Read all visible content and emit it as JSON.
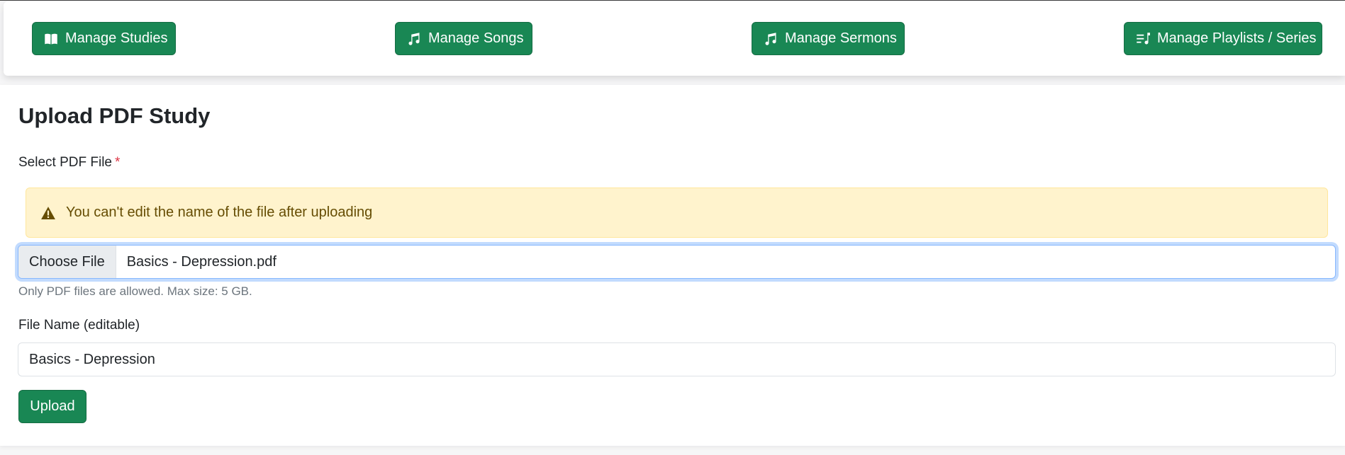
{
  "nav": {
    "buttons": [
      {
        "label": "Manage Studies",
        "icon": "book-icon"
      },
      {
        "label": "Manage Songs",
        "icon": "music-note-icon"
      },
      {
        "label": "Manage Sermons",
        "icon": "music-note-icon"
      },
      {
        "label": "Manage Playlists / Series",
        "icon": "playlist-icon"
      }
    ]
  },
  "form": {
    "title": "Upload PDF Study",
    "file_label": "Select PDF File",
    "required_mark": "*",
    "alert_text": "You can't edit the name of the file after uploading",
    "choose_file_label": "Choose File",
    "selected_file": "Basics - Depression.pdf",
    "help_text": "Only PDF files are allowed. Max size: 5 GB.",
    "name_label": "File Name (editable)",
    "name_value": "Basics - Depression",
    "upload_label": "Upload"
  },
  "colors": {
    "primary": "#198754",
    "alert_bg": "#fff3cd",
    "alert_text": "#664d03",
    "required": "#dc3545"
  }
}
